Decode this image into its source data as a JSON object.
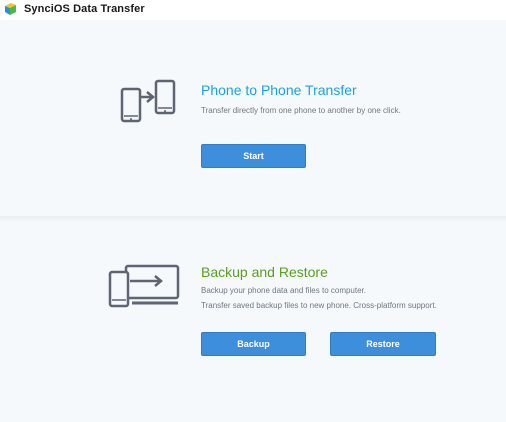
{
  "window": {
    "title": "SynciOS Data Transfer",
    "logo_icon": "syncios-logo-icon"
  },
  "phone_transfer": {
    "icon": "phone-to-phone-icon",
    "title": "Phone to Phone Transfer",
    "title_color": "#1aa3e0",
    "description": "Transfer directly from one phone to another by one click.",
    "start_label": "Start"
  },
  "backup_restore": {
    "icon": "phone-to-computer-icon",
    "title": "Backup and Restore",
    "title_color": "#5a9e1e",
    "description_lines": [
      "Backup your phone data and files to computer.",
      "Transfer saved backup files to new phone. Cross-platform support."
    ],
    "backup_label": "Backup",
    "restore_label": "Restore"
  },
  "colors": {
    "button": "#3d8fdc",
    "icon": "#5e6472"
  }
}
